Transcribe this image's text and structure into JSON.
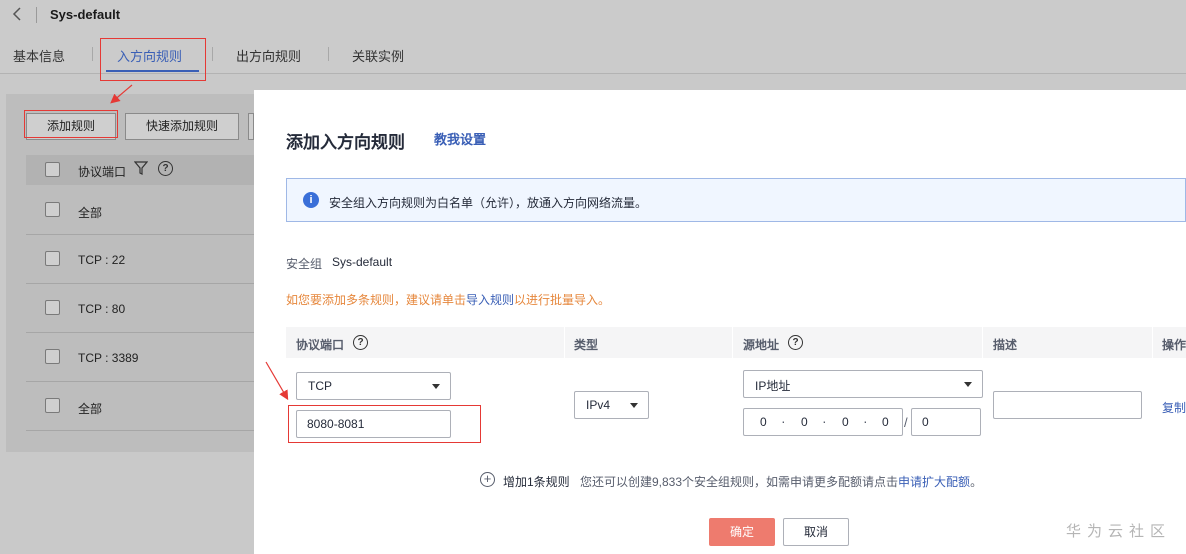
{
  "header": {
    "title": "Sys-default",
    "back_icon": "chevron-left-icon"
  },
  "tabs": [
    {
      "label": "基本信息"
    },
    {
      "label": "入方向规则",
      "active": true
    },
    {
      "label": "出方向规则"
    },
    {
      "label": "关联实例"
    }
  ],
  "background": {
    "add_rule_btn": "添加规则",
    "quick_add_btn": "快速添加规则",
    "table_header": "协议端口",
    "rows": [
      "全部",
      "TCP : 22",
      "TCP : 80",
      "TCP : 3389",
      "全部"
    ]
  },
  "dialog": {
    "title": "添加入方向规则",
    "help_link": "教我设置",
    "info": "安全组入方向规则为白名单（允许），放通入方向网络流量。",
    "sg_label": "安全组",
    "sg_value": "Sys-default",
    "hint_prefix": "如您要添加多条规则，建议请单击",
    "hint_link": "导入规则",
    "hint_suffix": "以进行批量导入。",
    "columns": {
      "protocol": "协议端口",
      "type": "类型",
      "source": "源地址",
      "desc": "描述",
      "op": "操作"
    },
    "protocol_value": "TCP",
    "port_value": "8080-8081",
    "type_value": "IPv4",
    "source_type": "IP地址",
    "ip": [
      "0",
      "0",
      "0",
      "0"
    ],
    "mask": "0",
    "description_value": "",
    "op_copy": "复制",
    "add_rule_label": "增加1条规则",
    "quota_prefix": "您还可以创建9,833个安全组规则，如需申请更多配额请点击",
    "quota_link": "申请扩大配额",
    "quota_suffix": "。",
    "ok_label": "确定",
    "cancel_label": "取消"
  },
  "watermark": "华为云社区",
  "colors": {
    "accent": "#3a5fb6",
    "ok": "#ee7b6e",
    "annotation": "#e53935",
    "hint": "#e6873c"
  }
}
